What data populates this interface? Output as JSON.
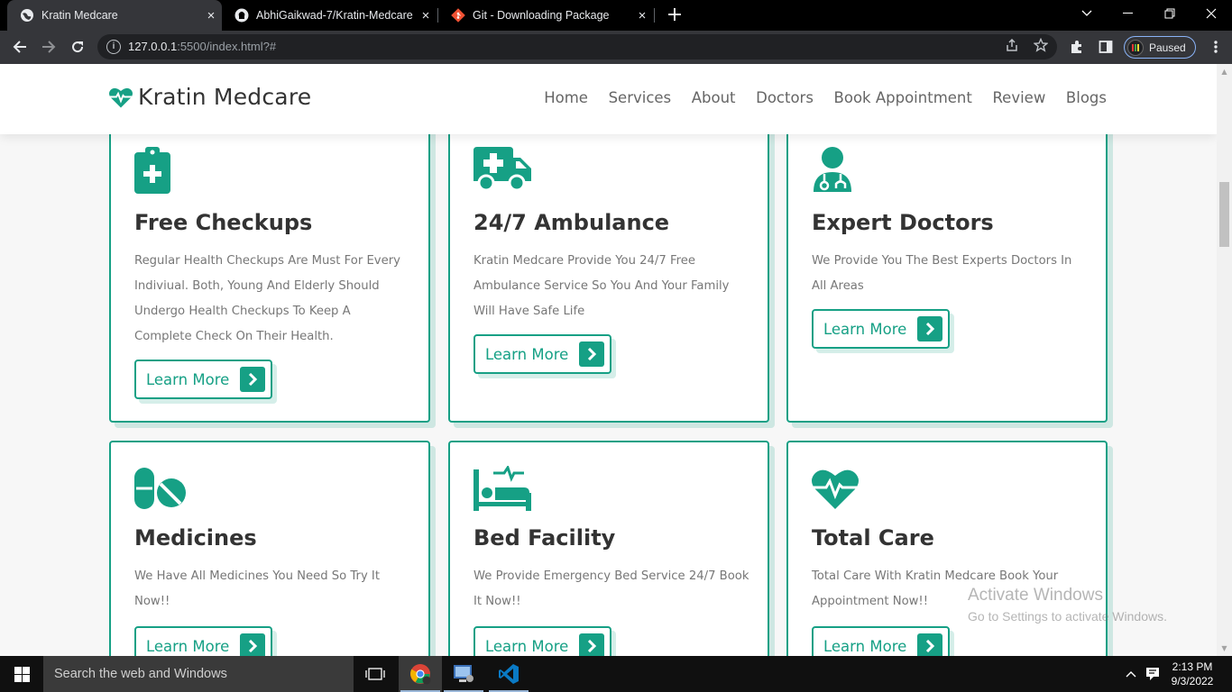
{
  "browser": {
    "tabs": [
      {
        "title": "Kratin Medcare",
        "active": true
      },
      {
        "title": "AbhiGaikwad-7/Kratin-Medcare",
        "active": false
      },
      {
        "title": "Git - Downloading Package",
        "active": false
      }
    ],
    "new_tab_symbol": "+",
    "close_symbol": "×",
    "address": {
      "host": "127.0.0.1",
      "rest": ":5500/index.html?#"
    },
    "profile_status": "Paused"
  },
  "site": {
    "logo_text": "Kratin Medcare",
    "nav": [
      "Home",
      "Services",
      "About",
      "Doctors",
      "Book Appointment",
      "Review",
      "Blogs"
    ],
    "services": [
      {
        "title": "Free Checkups",
        "text": "Regular Health Checkups Are Must For Every Indiviual. Both, Young And Elderly Should Undergo Health Checkups To Keep A Complete Check On Their Health.",
        "button": "Learn More",
        "icon": "clipboard-medical-icon"
      },
      {
        "title": "24/7 Ambulance",
        "text": "Kratin Medcare Provide You 24/7 Free Ambulance Service So You And Your Family Will Have Safe Life",
        "button": "Learn More",
        "icon": "ambulance-icon"
      },
      {
        "title": "Expert Doctors",
        "text": "We Provide You The Best Experts Doctors In All Areas",
        "button": "Learn More",
        "icon": "doctor-icon"
      },
      {
        "title": "Medicines",
        "text": "We Have All Medicines You Need So Try It Now!!",
        "button": "Learn More",
        "icon": "pills-icon"
      },
      {
        "title": "Bed Facility",
        "text": "We Provide Emergency Bed Service 24/7 Book It Now!!",
        "button": "Learn More",
        "icon": "procedures-bed-icon"
      },
      {
        "title": "Total Care",
        "text": "Total Care With Kratin Medcare Book Your Appointment Now!!",
        "button": "Learn More",
        "icon": "heartbeat-icon"
      }
    ],
    "accent_color": "#16a085"
  },
  "watermark": {
    "line1": "Activate Windows",
    "line2": "Go to Settings to activate Windows."
  },
  "taskbar": {
    "search_placeholder": "Search the web and Windows",
    "time": "2:13 PM",
    "date": "9/3/2022"
  }
}
